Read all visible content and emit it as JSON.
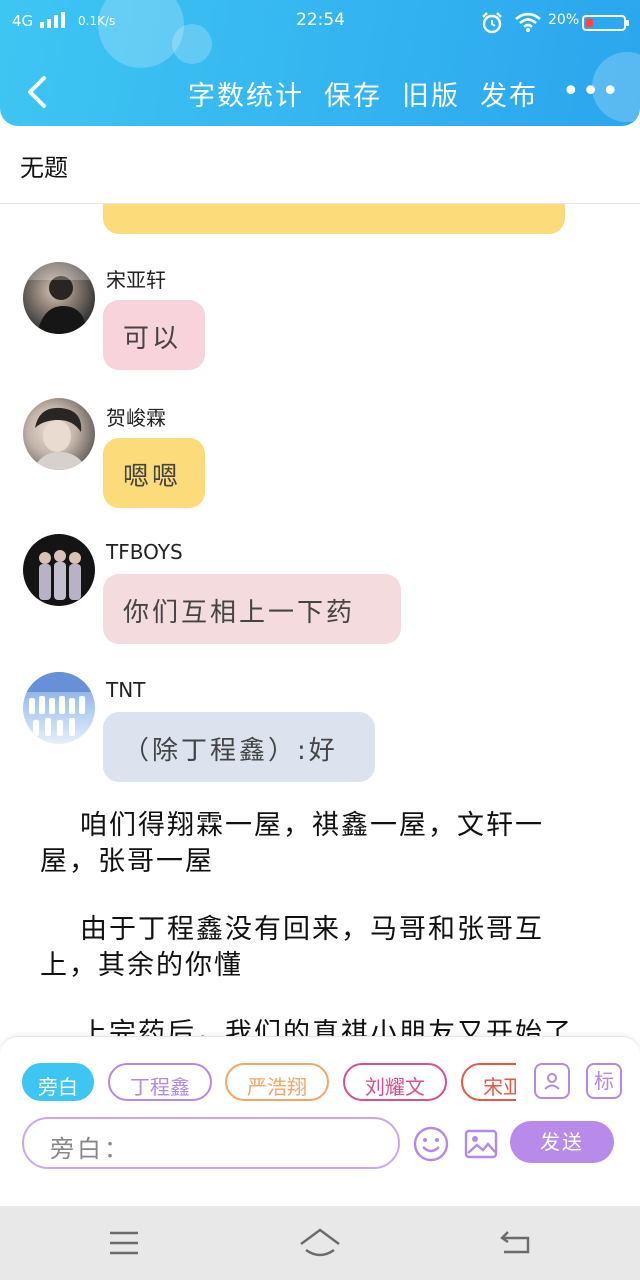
{
  "status_bar": {
    "network": "4G",
    "speed": "0.1K/s",
    "time": "22:54",
    "battery": "20%",
    "battery_level": 0.2
  },
  "header": {
    "word_count": "字数统计",
    "save": "保存",
    "old_version": "旧版",
    "publish": "发布",
    "more": "•••"
  },
  "document": {
    "title": "无题"
  },
  "messages": [
    {
      "sender": "宋亚轩",
      "text": "可以",
      "bubble_color": "#f9d3db"
    },
    {
      "sender": "贺峻霖",
      "text": "嗯嗯",
      "bubble_color": "#fbdb7a"
    },
    {
      "sender": "TFBOYS",
      "text": "你们互相上一下药",
      "bubble_color": "#f4dbdd"
    },
    {
      "sender": "TNT",
      "text": "（除丁程鑫）:好",
      "bubble_color": "#dde3ee"
    }
  ],
  "paragraphs": [
    "咱们得翔霖一屋，祺鑫一屋，文轩一屋，张哥一屋",
    "由于丁程鑫没有回来，马哥和张哥互上，其余的你懂",
    "上完药后，我们的真祺小朋友又开始了"
  ],
  "composer": {
    "chips": [
      {
        "label": "旁白",
        "color": "#3ec6f2",
        "active": true
      },
      {
        "label": "丁程鑫",
        "color": "#b28ae6",
        "active": false
      },
      {
        "label": "严浩翔",
        "color": "#f2a66a",
        "active": false
      },
      {
        "label": "刘耀文",
        "color": "#d6508e",
        "active": false
      },
      {
        "label": "宋亚轩",
        "color": "#e05a4a",
        "active": false
      }
    ],
    "tag_button": "标",
    "placeholder": "旁白：",
    "send": "发送"
  }
}
